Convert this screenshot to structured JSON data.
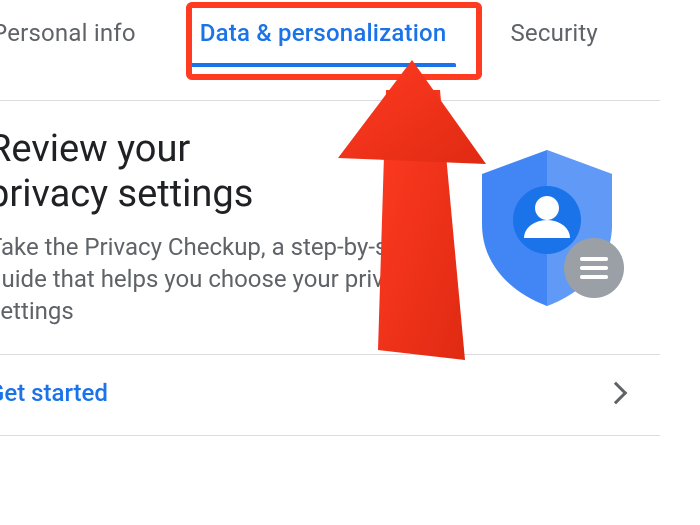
{
  "tabs": {
    "personal_info": "Personal info",
    "data_personalization": "Data & personalization",
    "security": "Security"
  },
  "card": {
    "title_line1": "Review your",
    "title_line2": "privacy settings",
    "description": "Take the Privacy Checkup, a step-by-step guide that helps you choose your privacy settings",
    "cta": "Get started"
  },
  "colors": {
    "accent": "#1a73e8",
    "highlight": "#ff3b22",
    "text_primary": "#202124",
    "text_secondary": "#5f6368",
    "divider": "#dadce0",
    "shield_blue": "#4285f4",
    "badge_grey": "#9aa0a6"
  },
  "icons": {
    "shield": "shield-icon",
    "avatar": "avatar-icon",
    "list_badge": "list-badge-icon",
    "chevron_right": "chevron-right-icon"
  }
}
